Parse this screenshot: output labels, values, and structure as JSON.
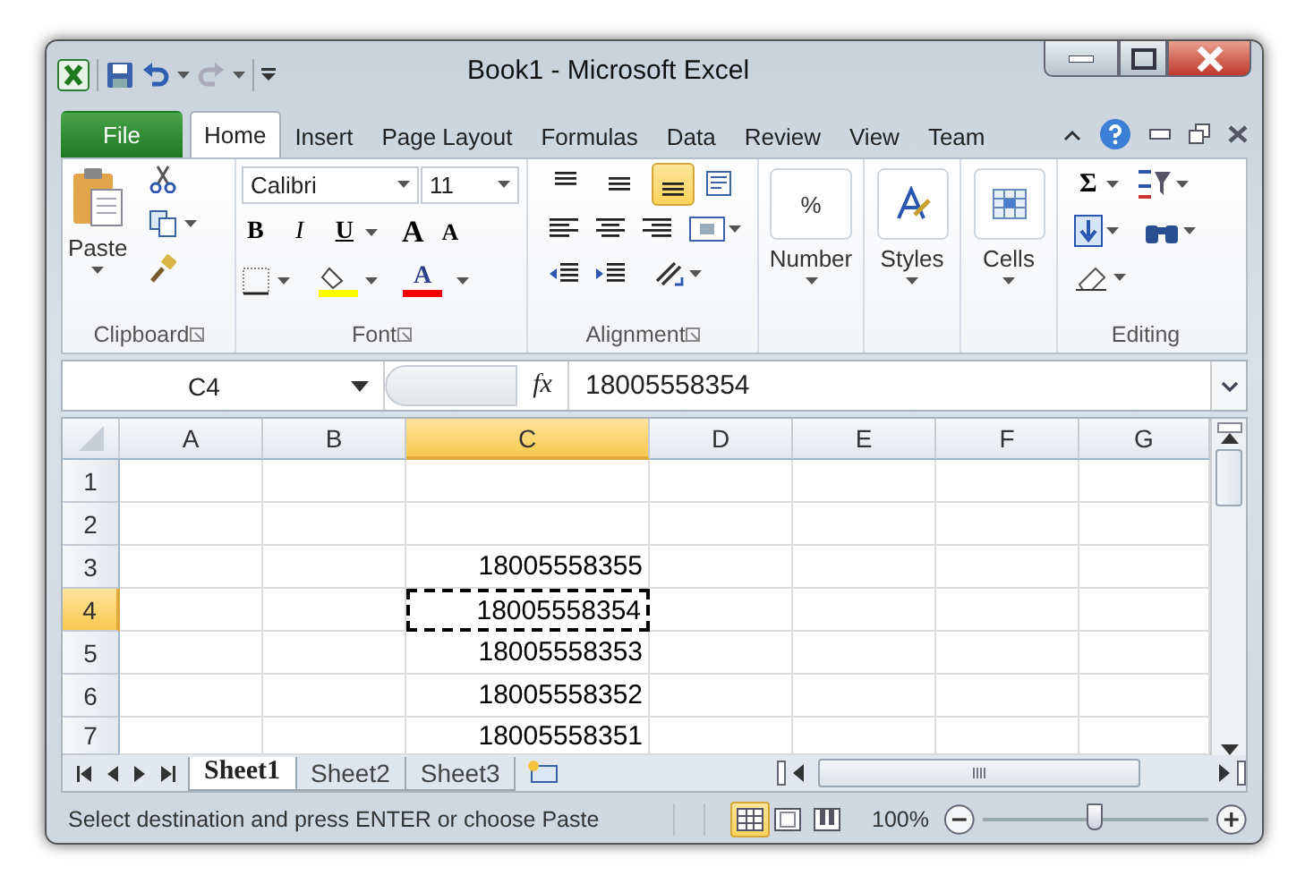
{
  "window": {
    "title": "Book1 - Microsoft Excel"
  },
  "ribbon_tabs": [
    {
      "label": "File",
      "kind": "file",
      "selected": false
    },
    {
      "label": "Home",
      "kind": "tab",
      "selected": true
    },
    {
      "label": "Insert",
      "kind": "tab",
      "selected": false
    },
    {
      "label": "Page Layout",
      "kind": "tab",
      "selected": false
    },
    {
      "label": "Formulas",
      "kind": "tab",
      "selected": false
    },
    {
      "label": "Data",
      "kind": "tab",
      "selected": false
    },
    {
      "label": "Review",
      "kind": "tab",
      "selected": false
    },
    {
      "label": "View",
      "kind": "tab",
      "selected": false
    },
    {
      "label": "Team",
      "kind": "tab",
      "selected": false
    }
  ],
  "ribbon": {
    "clipboard": {
      "paste": "Paste",
      "label": "Clipboard"
    },
    "font": {
      "font_name": "Calibri",
      "font_size": "11",
      "bold": "B",
      "italic": "I",
      "underline": "U",
      "grow": "A",
      "shrink": "A",
      "font_color": "A",
      "label": "Font"
    },
    "alignment": {
      "label": "Alignment",
      "vertical": [
        {
          "kind": "top",
          "selected": false
        },
        {
          "kind": "middle",
          "selected": false
        },
        {
          "kind": "bottom",
          "selected": true
        }
      ]
    },
    "number": {
      "symbol": "%",
      "label": "Number"
    },
    "styles": {
      "label": "Styles"
    },
    "cells": {
      "label": "Cells"
    },
    "editing": {
      "sum": "Σ",
      "label": "Editing"
    }
  },
  "formula_bar": {
    "name_box": "C4",
    "function_label": "fx",
    "value": "18005558354"
  },
  "columns": [
    {
      "label": "A",
      "selected": false
    },
    {
      "label": "B",
      "selected": false
    },
    {
      "label": "C",
      "selected": true
    },
    {
      "label": "D",
      "selected": false
    },
    {
      "label": "E",
      "selected": false
    },
    {
      "label": "F",
      "selected": false
    },
    {
      "label": "G",
      "selected": false
    }
  ],
  "rows": [
    {
      "header": "1",
      "selected": false
    },
    {
      "header": "2",
      "selected": false
    },
    {
      "header": "3",
      "selected": false,
      "column_c": {
        "value": "18005558355",
        "active": false
      }
    },
    {
      "header": "4",
      "selected": true,
      "column_c": {
        "value": "18005558354",
        "active": true
      }
    },
    {
      "header": "5",
      "selected": false,
      "column_c": {
        "value": "18005558353",
        "active": false
      }
    },
    {
      "header": "6",
      "selected": false,
      "column_c": {
        "value": "18005558352",
        "active": false
      }
    },
    {
      "header": "7",
      "selected": false,
      "column_c": {
        "value": "18005558351",
        "active": false
      }
    }
  ],
  "sheet_tabs": [
    {
      "label": "Sheet1",
      "selected": true
    },
    {
      "label": "Sheet2",
      "selected": false
    },
    {
      "label": "Sheet3",
      "selected": false
    }
  ],
  "status_bar": {
    "message": "Select destination and press ENTER or choose Paste",
    "views": [
      {
        "kind": "normal",
        "selected": true
      },
      {
        "kind": "page_layout",
        "selected": false
      },
      {
        "kind": "page_break",
        "selected": false
      }
    ],
    "zoom": "100%",
    "zoom_slider": {
      "level": 0.5
    }
  }
}
